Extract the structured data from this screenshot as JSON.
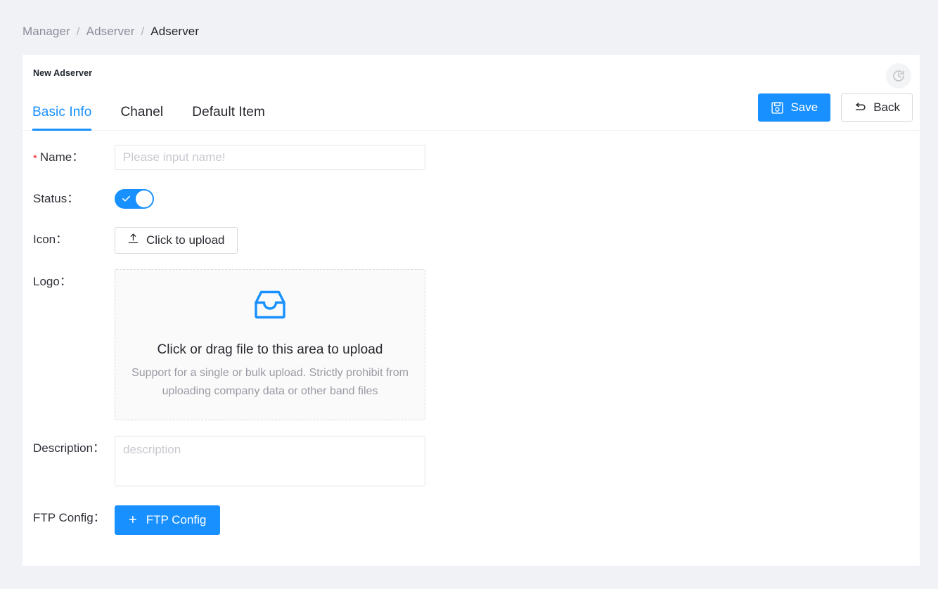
{
  "breadcrumb": {
    "items": [
      {
        "label": "Manager",
        "current": false
      },
      {
        "label": "Adserver",
        "current": false
      },
      {
        "label": "Adserver",
        "current": true
      }
    ],
    "separator": "/"
  },
  "card": {
    "title": "New Adserver",
    "history_icon": "clock-history-icon"
  },
  "tabs": [
    {
      "label": "Basic Info",
      "active": true
    },
    {
      "label": "Chanel",
      "active": false
    },
    {
      "label": "Default Item",
      "active": false
    }
  ],
  "actions": {
    "save_label": "Save",
    "save_icon": "save-floppy-icon",
    "back_label": "Back",
    "back_icon": "rollback-icon"
  },
  "form": {
    "name": {
      "label": "Name：",
      "required_marker": "*",
      "value": "",
      "placeholder": "Please input name!"
    },
    "status": {
      "label": "Status：",
      "checked": true,
      "icon": "check-icon"
    },
    "icon": {
      "label": "Icon：",
      "upload_label": "Click to upload",
      "upload_icon": "upload-icon"
    },
    "logo": {
      "label": "Logo：",
      "dragger_icon": "inbox-icon",
      "dragger_title": "Click or drag file to this area to upload",
      "dragger_hint": "Support for a single or bulk upload. Strictly prohibit from uploading company data or other band files"
    },
    "description": {
      "label": "Description：",
      "value": "",
      "placeholder": "description"
    },
    "ftp": {
      "label": "FTP Config：",
      "button_label": "FTP Config",
      "button_icon": "plus-icon"
    }
  },
  "colors": {
    "primary": "#1890ff",
    "page_background": "#f0f2f5",
    "card_background": "#ffffff",
    "required_red": "#f5222d",
    "text": "#31313a",
    "muted_text": "#9a9aa4"
  }
}
